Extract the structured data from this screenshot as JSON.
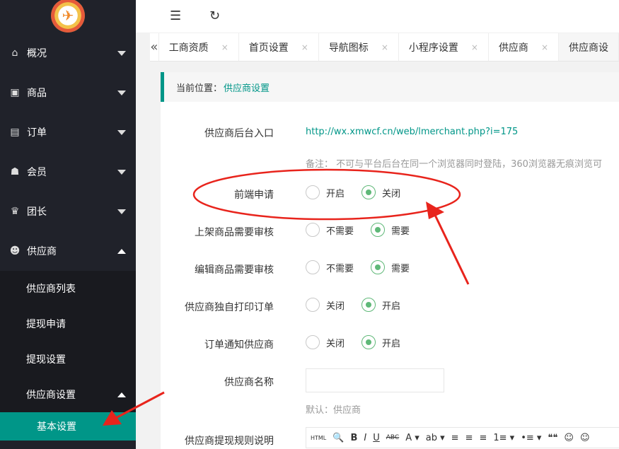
{
  "sidebar": {
    "logo_icon": "airplane-logo",
    "items": [
      {
        "label": "概况",
        "icon": "home-icon"
      },
      {
        "label": "商品",
        "icon": "shirt-icon"
      },
      {
        "label": "订单",
        "icon": "file-icon"
      },
      {
        "label": "会员",
        "icon": "users-icon"
      },
      {
        "label": "团长",
        "icon": "crown-icon"
      },
      {
        "label": "供应商",
        "icon": "supplier-icon"
      }
    ],
    "sub_items": [
      "供应商列表",
      "提现申请",
      "提现设置",
      "供应商设置"
    ],
    "sub_sub_item": "基本设置"
  },
  "topbar": {
    "collapse_icon": "menu-collapse-icon",
    "refresh_icon": "refresh-icon"
  },
  "tabs": {
    "items": [
      "工商资质",
      "首页设置",
      "导航图标",
      "小程序设置",
      "供应商",
      "供应商设"
    ],
    "close": "×",
    "scroll_left": "«"
  },
  "breadcrumb": {
    "prefix": "当前位置：",
    "current": "供应商设置"
  },
  "form": {
    "entry_label": "供应商后台入口",
    "entry_url": "http://wx.xmwcf.cn/web/lmerchant.php?i=175",
    "entry_note": "备注：  不可与平台后台在同一个浏览器同时登陆，360浏览器无痕浏览可",
    "apply_label": "前端申请",
    "apply_options": [
      "开启",
      "关闭"
    ],
    "listing_label": "上架商品需要审核",
    "listing_options": [
      "不需要",
      "需要"
    ],
    "edit_label": "编辑商品需要审核",
    "edit_options": [
      "不需要",
      "需要"
    ],
    "print_label": "供应商独自打印订单",
    "print_options": [
      "关闭",
      "开启"
    ],
    "notify_label": "订单通知供应商",
    "notify_options": [
      "关闭",
      "开启"
    ],
    "name_label": "供应商名称",
    "name_value": "",
    "name_default": "默认：供应商",
    "rules_label": "供应商提现规则说明"
  },
  "editor_toolbar": [
    "HTML",
    "🔍",
    "B",
    "I",
    "U",
    "ABC",
    "A ▾",
    "ab ▾",
    "≡",
    "≡",
    "≡",
    "1≡ ▾",
    "•≡ ▾",
    "❝❝",
    "☺",
    "☺"
  ],
  "accent_color": "#009688",
  "annotation_color": "#e8241c"
}
